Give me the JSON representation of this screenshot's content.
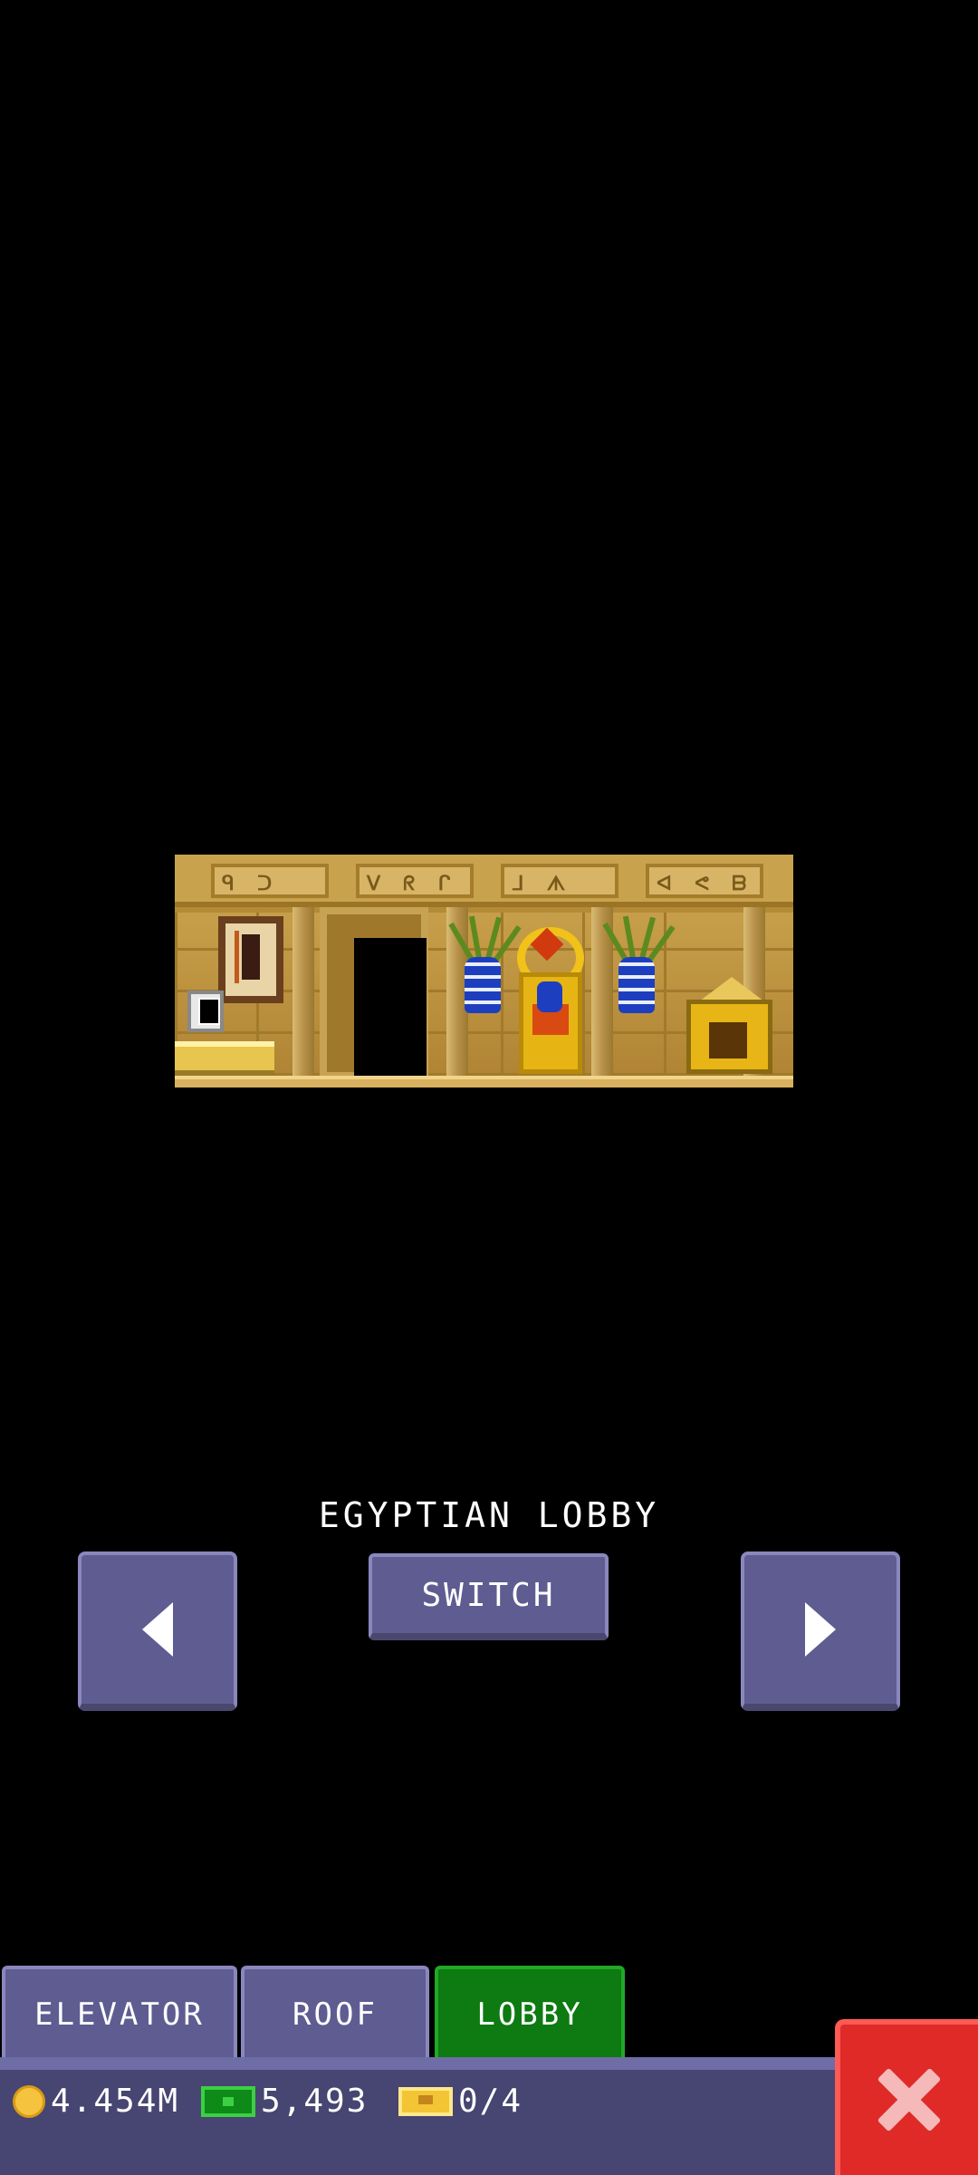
{
  "lobby": {
    "name": "EGYPTIAN LOBBY"
  },
  "controls": {
    "switch_label": "SWITCH",
    "prev_icon": "arrow-left-icon",
    "next_icon": "arrow-right-icon"
  },
  "tabs": [
    {
      "label": "ELEVATOR",
      "active": false
    },
    {
      "label": "ROOF",
      "active": false
    },
    {
      "label": "LOBBY",
      "active": true
    }
  ],
  "status": {
    "coins": "4.454M",
    "bux": "5,493",
    "tickets": "0/4"
  },
  "colors": {
    "button": "#5f5c91",
    "active_tab": "#0d7a12",
    "close": "#e02a28"
  }
}
